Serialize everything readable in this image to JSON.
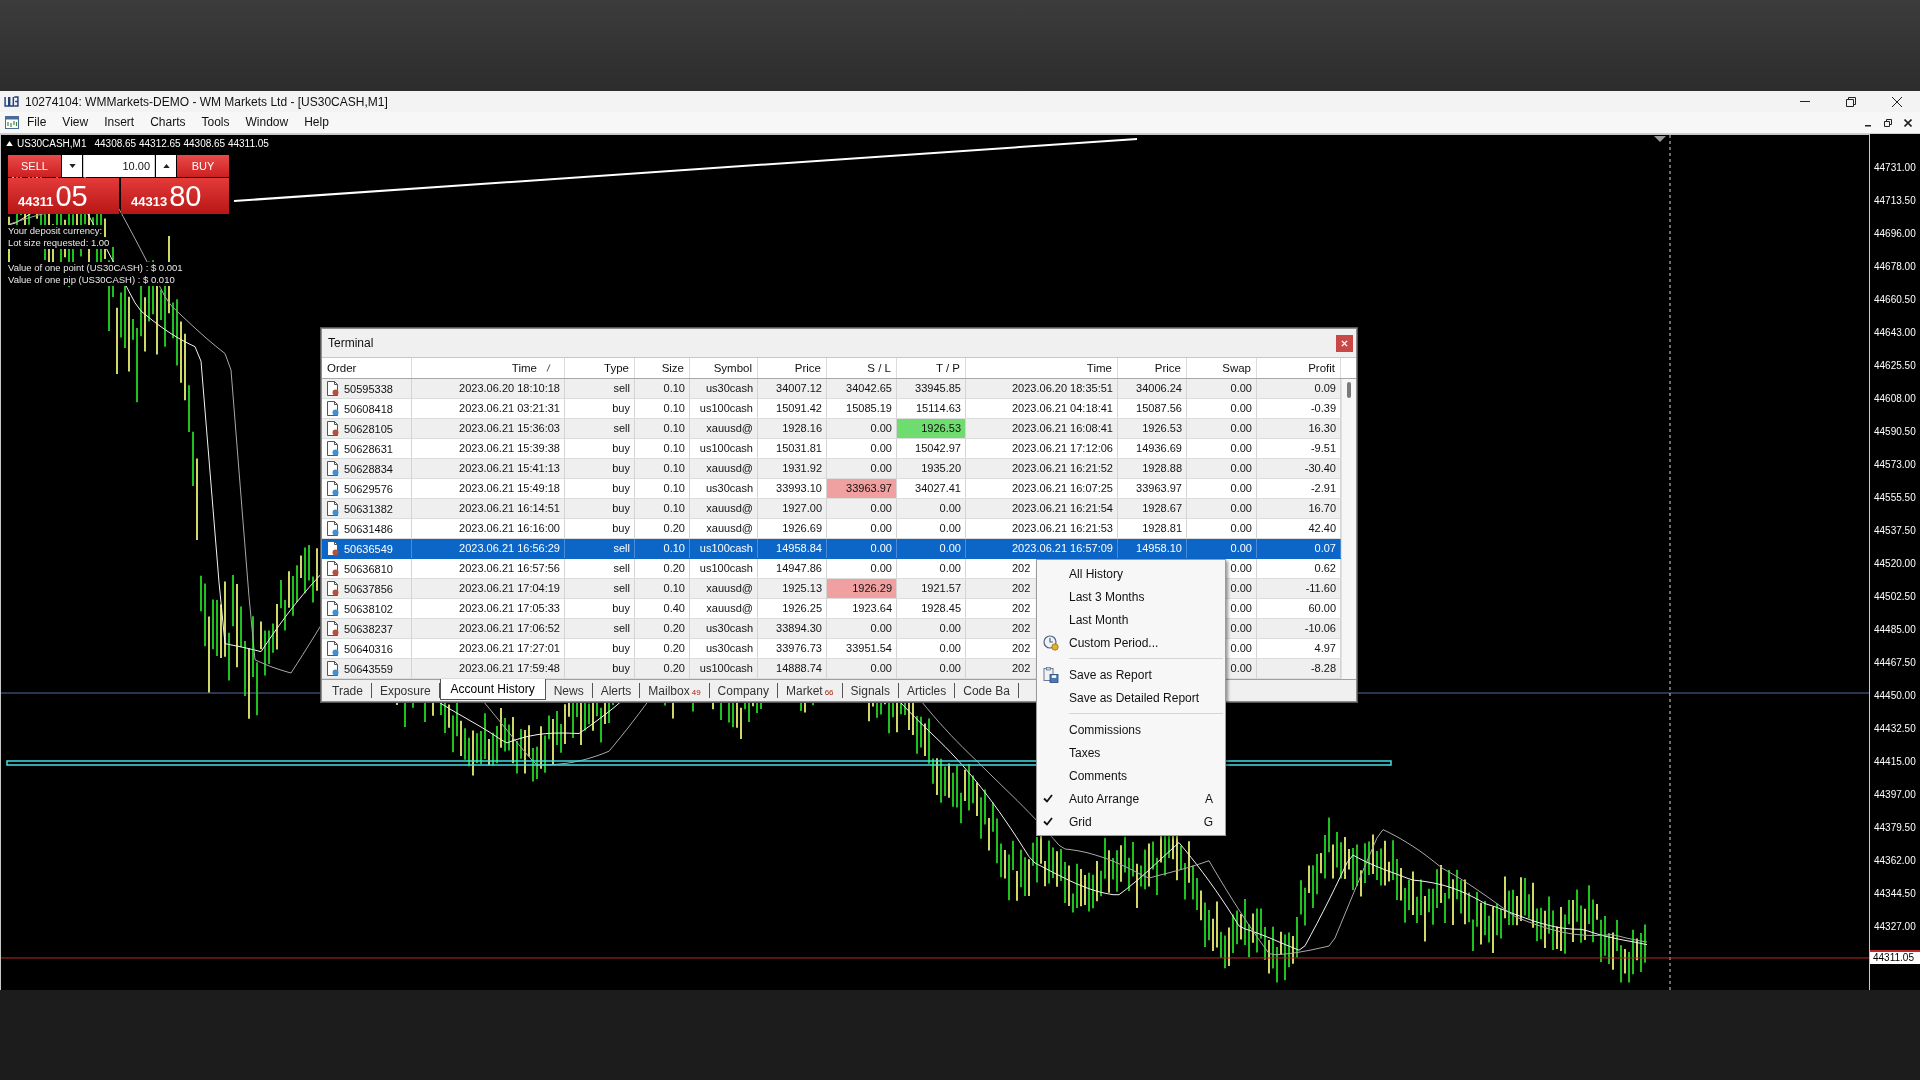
{
  "window": {
    "title": "10274104: WMMarkets-DEMO - WM Markets Ltd - [US30CASH,M1]"
  },
  "menu_bar": {
    "items": [
      "File",
      "View",
      "Insert",
      "Charts",
      "Tools",
      "Window",
      "Help"
    ]
  },
  "chart": {
    "symbol": "US30CASH,M1",
    "ohlc": "44308.65 44312.65 44308.65 44311.05",
    "one_click": {
      "sell_label": "SELL",
      "lot": "10.00",
      "buy_label": "BUY",
      "sell_price_main": "44311",
      "sell_price_pips": "05",
      "buy_price_main": "44313",
      "buy_price_pips": "80"
    },
    "info_lines": [
      "Your deposit currency:",
      "Lot size requested: 1.00",
      "Value of one point (US30CASH) : $ 0.001",
      "Value of one pip (US30CASH) : $ 0.010"
    ],
    "price_axis": {
      "labels": [
        "44731.00",
        "44713.50",
        "44696.00",
        "44678.00",
        "44660.50",
        "44643.00",
        "44625.50",
        "44608.00",
        "44590.50",
        "44573.00",
        "44555.50",
        "44537.50",
        "44520.00",
        "44502.50",
        "44485.00",
        "44467.50",
        "44450.00",
        "44432.50",
        "44415.00",
        "44397.00",
        "44379.50",
        "44362.00",
        "44344.50",
        "44327.00"
      ],
      "current_price": "44311.05"
    }
  },
  "terminal": {
    "title": "Terminal",
    "columns": [
      {
        "label": "Order",
        "sorted": false
      },
      {
        "label": "Time",
        "sorted": true
      },
      {
        "label": "Type",
        "sorted": false
      },
      {
        "label": "Size",
        "sorted": false
      },
      {
        "label": "Symbol",
        "sorted": false
      },
      {
        "label": "Price",
        "sorted": false
      },
      {
        "label": "S / L",
        "sorted": false
      },
      {
        "label": "T / P",
        "sorted": false
      },
      {
        "label": "Time",
        "sorted": false
      },
      {
        "label": "Price",
        "sorted": false
      },
      {
        "label": "Swap",
        "sorted": false
      },
      {
        "label": "Profit",
        "sorted": false
      }
    ],
    "rows": [
      {
        "order": "50595338",
        "open_time": "2023.06.20 18:10:18",
        "type": "sell",
        "size": "0.10",
        "symbol": "us30cash",
        "open_price": "34007.12",
        "sl": "34042.65",
        "tp": "33945.85",
        "close_time": "2023.06.20 18:35:51",
        "close_price": "34006.24",
        "swap": "0.00",
        "profit": "0.09",
        "color": "#b4503c",
        "selected": false,
        "sl_hit": false,
        "tp_hit": false
      },
      {
        "order": "50608418",
        "open_time": "2023.06.21 03:21:31",
        "type": "buy",
        "size": "0.10",
        "symbol": "us100cash",
        "open_price": "15091.42",
        "sl": "15085.19",
        "tp": "15114.63",
        "close_time": "2023.06.21 04:18:41",
        "close_price": "15087.56",
        "swap": "0.00",
        "profit": "-0.39",
        "color": "#3f8fd2",
        "selected": false,
        "sl_hit": false,
        "tp_hit": false
      },
      {
        "order": "50628105",
        "open_time": "2023.06.21 15:36:03",
        "type": "sell",
        "size": "0.10",
        "symbol": "xauusd@",
        "open_price": "1928.16",
        "sl": "0.00",
        "tp": "1926.53",
        "close_time": "2023.06.21 16:08:41",
        "close_price": "1926.53",
        "swap": "0.00",
        "profit": "16.30",
        "color": "#b4503c",
        "selected": false,
        "sl_hit": false,
        "tp_hit": true
      },
      {
        "order": "50628631",
        "open_time": "2023.06.21 15:39:38",
        "type": "buy",
        "size": "0.10",
        "symbol": "us100cash",
        "open_price": "15031.81",
        "sl": "0.00",
        "tp": "15042.97",
        "close_time": "2023.06.21 17:12:06",
        "close_price": "14936.69",
        "swap": "0.00",
        "profit": "-9.51",
        "color": "#3f8fd2",
        "selected": false,
        "sl_hit": false,
        "tp_hit": false
      },
      {
        "order": "50628834",
        "open_time": "2023.06.21 15:41:13",
        "type": "buy",
        "size": "0.10",
        "symbol": "xauusd@",
        "open_price": "1931.92",
        "sl": "0.00",
        "tp": "1935.20",
        "close_time": "2023.06.21 16:21:52",
        "close_price": "1928.88",
        "swap": "0.00",
        "profit": "-30.40",
        "color": "#3f8fd2",
        "selected": false,
        "sl_hit": false,
        "tp_hit": false
      },
      {
        "order": "50629576",
        "open_time": "2023.06.21 15:49:18",
        "type": "buy",
        "size": "0.10",
        "symbol": "us30cash",
        "open_price": "33993.10",
        "sl": "33963.97",
        "tp": "34027.41",
        "close_time": "2023.06.21 16:07:25",
        "close_price": "33963.97",
        "swap": "0.00",
        "profit": "-2.91",
        "color": "#3f8fd2",
        "selected": false,
        "sl_hit": true,
        "tp_hit": false
      },
      {
        "order": "50631382",
        "open_time": "2023.06.21 16:14:51",
        "type": "buy",
        "size": "0.10",
        "symbol": "xauusd@",
        "open_price": "1927.00",
        "sl": "0.00",
        "tp": "0.00",
        "close_time": "2023.06.21 16:21:54",
        "close_price": "1928.67",
        "swap": "0.00",
        "profit": "16.70",
        "color": "#3f8fd2",
        "selected": false,
        "sl_hit": false,
        "tp_hit": false
      },
      {
        "order": "50631486",
        "open_time": "2023.06.21 16:16:00",
        "type": "buy",
        "size": "0.20",
        "symbol": "xauusd@",
        "open_price": "1926.69",
        "sl": "0.00",
        "tp": "0.00",
        "close_time": "2023.06.21 16:21:53",
        "close_price": "1928.81",
        "swap": "0.00",
        "profit": "42.40",
        "color": "#3f8fd2",
        "selected": false,
        "sl_hit": false,
        "tp_hit": false
      },
      {
        "order": "50636549",
        "open_time": "2023.06.21 16:56:29",
        "type": "sell",
        "size": "0.10",
        "symbol": "us100cash",
        "open_price": "14958.84",
        "sl": "0.00",
        "tp": "0.00",
        "close_time": "2023.06.21 16:57:09",
        "close_price": "14958.10",
        "swap": "0.00",
        "profit": "0.07",
        "color": "#b4503c",
        "selected": true,
        "sl_hit": false,
        "tp_hit": false
      },
      {
        "order": "50636810",
        "open_time": "2023.06.21 16:57:56",
        "type": "sell",
        "size": "0.20",
        "symbol": "us100cash",
        "open_price": "14947.86",
        "sl": "0.00",
        "tp": "0.00",
        "close_time": "202",
        "swap": "0.00",
        "profit": "0.62",
        "color": "#b4503c",
        "selected": false,
        "sl_hit": false,
        "tp_hit": false
      },
      {
        "order": "50637856",
        "open_time": "2023.06.21 17:04:19",
        "type": "sell",
        "size": "0.10",
        "symbol": "xauusd@",
        "open_price": "1925.13",
        "sl": "1926.29",
        "tp": "1921.57",
        "close_time": "202",
        "swap": "0.00",
        "profit": "-11.60",
        "color": "#b4503c",
        "selected": false,
        "sl_hit": true,
        "tp_hit": false
      },
      {
        "order": "50638102",
        "open_time": "2023.06.21 17:05:33",
        "type": "buy",
        "size": "0.40",
        "symbol": "xauusd@",
        "open_price": "1926.25",
        "sl": "1923.64",
        "tp": "1928.45",
        "close_time": "202",
        "swap": "0.00",
        "profit": "60.00",
        "color": "#3f8fd2",
        "selected": false,
        "sl_hit": false,
        "tp_hit": false
      },
      {
        "order": "50638237",
        "open_time": "2023.06.21 17:06:52",
        "type": "sell",
        "size": "0.20",
        "symbol": "us30cash",
        "open_price": "33894.30",
        "sl": "0.00",
        "tp": "0.00",
        "close_time": "202",
        "swap": "0.00",
        "profit": "-10.06",
        "color": "#b4503c",
        "selected": false,
        "sl_hit": false,
        "tp_hit": false
      },
      {
        "order": "50640316",
        "open_time": "2023.06.21 17:27:01",
        "type": "buy",
        "size": "0.20",
        "symbol": "us30cash",
        "open_price": "33976.73",
        "sl": "33951.54",
        "tp": "0.00",
        "close_time": "202",
        "swap": "0.00",
        "profit": "4.97",
        "color": "#3f8fd2",
        "selected": false,
        "sl_hit": false,
        "tp_hit": false
      },
      {
        "order": "50643559",
        "open_time": "2023.06.21 17:59:48",
        "type": "buy",
        "size": "0.20",
        "symbol": "us100cash",
        "open_price": "14888.74",
        "sl": "0.00",
        "tp": "0.00",
        "close_time": "202",
        "swap": "0.00",
        "profit": "-8.28",
        "color": "#3f8fd2",
        "selected": false,
        "sl_hit": false,
        "tp_hit": false
      }
    ],
    "tabs": [
      {
        "label": "Trade",
        "selected": false
      },
      {
        "label": "Exposure",
        "selected": false
      },
      {
        "label": "Account History",
        "selected": true
      },
      {
        "label": "News",
        "selected": false
      },
      {
        "label": "Alerts",
        "selected": false
      },
      {
        "label": "Mailbox",
        "badge": "49",
        "selected": false
      },
      {
        "label": "Company",
        "selected": false
      },
      {
        "label": "Market",
        "badge": "66",
        "selected": false
      },
      {
        "label": "Signals",
        "selected": false
      },
      {
        "label": "Articles",
        "selected": false
      },
      {
        "label": "Code Ba",
        "selected": false
      }
    ]
  },
  "context_menu": {
    "sections": [
      [
        {
          "label": "All History",
          "kind": "plain",
          "checked": false
        },
        {
          "label": "Last 3 Months",
          "kind": "plain",
          "checked": false
        },
        {
          "label": "Last Month",
          "kind": "plain",
          "checked": false
        },
        {
          "label": "Custom Period...",
          "kind": "custom",
          "checked": false
        }
      ],
      [
        {
          "label": "Save as Report",
          "kind": "report",
          "checked": false
        },
        {
          "label": "Save as Detailed Report",
          "kind": "plain",
          "checked": false
        }
      ],
      [
        {
          "label": "Commissions",
          "kind": "plain",
          "checked": false
        },
        {
          "label": "Taxes",
          "kind": "plain",
          "checked": false
        },
        {
          "label": "Comments",
          "kind": "plain",
          "checked": false
        },
        {
          "label": "Auto Arrange",
          "kind": "plain",
          "checked": true,
          "shortcut": "A"
        },
        {
          "label": "Grid",
          "kind": "plain",
          "checked": true,
          "shortcut": "G"
        }
      ]
    ]
  }
}
